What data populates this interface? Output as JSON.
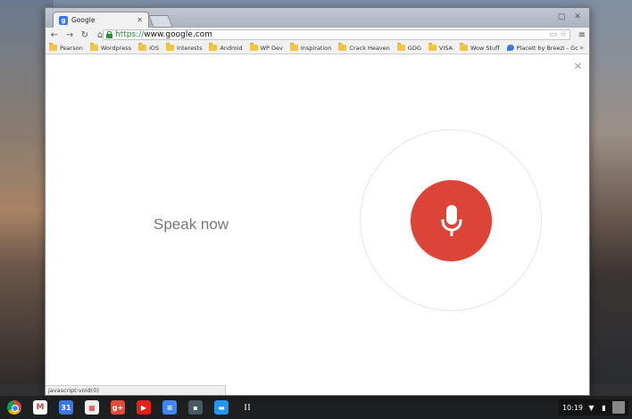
{
  "browser": {
    "tab": {
      "title": "Google",
      "favicon": "g"
    },
    "url": {
      "scheme": "https://",
      "host": "www.google.com"
    },
    "bookmarks": [
      "Pearson",
      "Wordpress",
      "iOS",
      "Interests",
      "Android",
      "WP Dev",
      "Inspiration",
      "Crack Heaven",
      "GDG",
      "VISA",
      "Wow Stuff",
      "PlaceIt by Breezi - Gc"
    ],
    "bookmarks_overflow": "»",
    "status_text": "javascript:void(0)"
  },
  "voice_search": {
    "prompt": "Speak now",
    "mic_color": "#db4437"
  },
  "shelf": {
    "apps": [
      "chrome-icon",
      "gmail-icon",
      "calendar-icon",
      "web-store-icon",
      "google-plus-icon",
      "youtube-icon",
      "docs-icon",
      "calculator-icon",
      "files-icon",
      "launcher-icon"
    ],
    "calendar_label": "31",
    "gplus_label": "g+",
    "clock": "10:19"
  }
}
